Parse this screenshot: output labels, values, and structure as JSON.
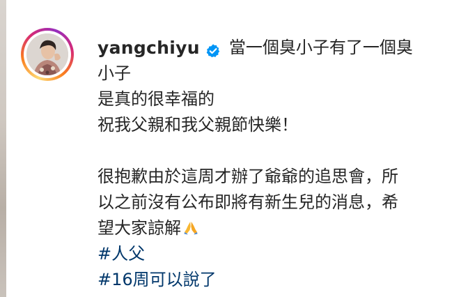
{
  "post": {
    "username": "yangchiyu",
    "caption_first": "當一個臭小子有了一個臭",
    "caption_lines": [
      "小子",
      "是真的很幸福的",
      "祝我父親和我父親節快樂！"
    ],
    "caption_lines_2": [
      "很抱歉由於這周才辦了爺爺的追思會，所",
      "以之前沒有公布即將有新生兒的消息，希",
      "望大家諒解"
    ],
    "hashtags": [
      "#人父",
      "#16周可以說了"
    ]
  },
  "icons": {
    "verified": "verified-badge-icon",
    "emoji": "folded-hands-emoji"
  },
  "colors": {
    "verified_blue": "#0095f6",
    "hashtag": "#00376b",
    "text": "#262626"
  }
}
